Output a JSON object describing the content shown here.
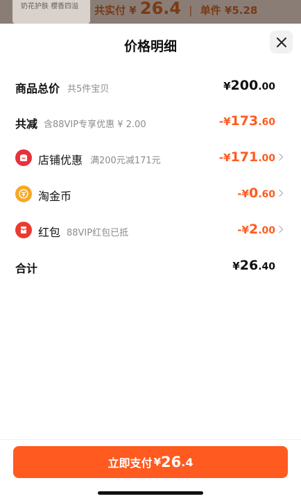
{
  "background": {
    "thumb_caption": "奶花护肤 櫻香四溢",
    "total_label": "共实付 ¥",
    "total_value": "26.4",
    "separator": "|",
    "unit_label": "单件 ¥5.28"
  },
  "sheet": {
    "title": "价格明细"
  },
  "rows": [
    {
      "label": "商品总价",
      "sub": "共5件宝贝",
      "yen": "¥",
      "int": "200",
      "dec": ".00"
    },
    {
      "label": "共减",
      "sub": "含88VIP专享优惠 ¥ 2.00",
      "yen": "-¥",
      "int": "173",
      "dec": ".60"
    },
    {
      "label": "店铺优惠",
      "sub": "满200元减171元",
      "yen": "-¥",
      "int": "171",
      "dec": ".00",
      "icon": "shop-icon"
    },
    {
      "label": "淘金币",
      "sub": "",
      "yen": "-¥",
      "int": "0",
      "dec": ".60",
      "icon": "coin-icon"
    },
    {
      "label": "红包",
      "sub": "88VIP红包已抵",
      "yen": "-¥",
      "int": "2",
      "dec": ".00",
      "icon": "red-packet-icon"
    },
    {
      "label": "合计",
      "sub": "",
      "yen": "¥",
      "int": "26",
      "dec": ".40"
    }
  ],
  "pay_button": {
    "label": "立即支付",
    "yen": "¥",
    "int": "26",
    "dec": ".4"
  },
  "colors": {
    "accent": "#ff5a1f",
    "shop_icon": "#e8313c",
    "coin_icon": "#f7a823",
    "red_packet_icon": "#ea3b2f"
  }
}
